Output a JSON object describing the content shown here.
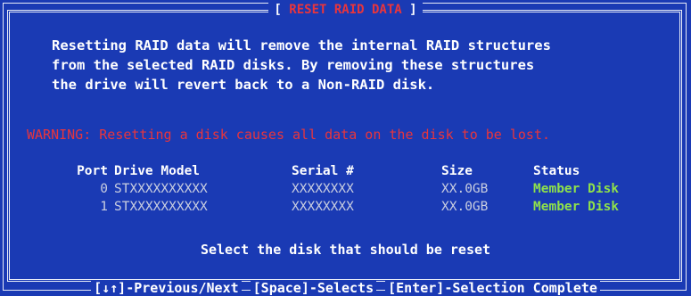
{
  "dialog": {
    "title_bracket_left": "[",
    "title": "RESET RAID DATA",
    "title_bracket_right": "]",
    "intro": [
      "Resetting RAID data will remove the internal RAID structures",
      "from the selected RAID disks. By removing these structures",
      "the drive will revert back to a Non-RAID disk."
    ],
    "warning": "WARNING: Resetting a disk causes all data on the disk to be lost.",
    "table": {
      "headers": {
        "port": "Port",
        "model": "Drive Model",
        "serial": "Serial #",
        "size": "Size",
        "status": "Status"
      },
      "rows": [
        {
          "port": "0",
          "model": "STXXXXXXXXXX",
          "serial": "XXXXXXXX",
          "size": "XX.0GB",
          "status": "Member Disk"
        },
        {
          "port": "1",
          "model": "STXXXXXXXXXX",
          "serial": "XXXXXXXX",
          "size": "XX.0GB",
          "status": "Member Disk"
        }
      ]
    },
    "prompt": "Select the disk that should be reset"
  },
  "footer": {
    "nav": "[↓↑]-Previous/Next",
    "select": "[Space]-Selects",
    "confirm": "[Enter]-Selection Complete"
  },
  "colors": {
    "background": "#1a3ab4",
    "warning": "#e8353d",
    "status": "#8fe14a",
    "text": "#ffffff",
    "muted": "#c9cee0"
  }
}
